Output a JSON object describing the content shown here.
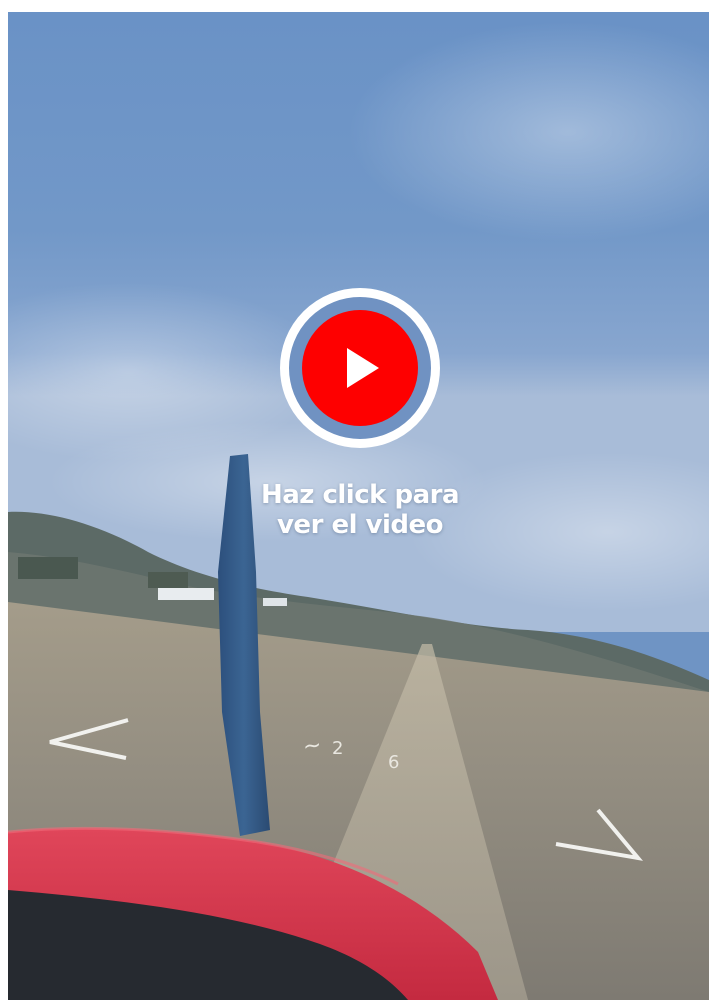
{
  "video": {
    "overlay_text_line1": "Haz click para",
    "overlay_text_line2": "ver el video",
    "play_icon": "play-icon"
  },
  "colors": {
    "play_red": "#fe0000",
    "ring_white": "#ffffff",
    "ring_fill": "#7092c2",
    "sky": "#6f94c4",
    "cowling_red": "#d9344a"
  }
}
